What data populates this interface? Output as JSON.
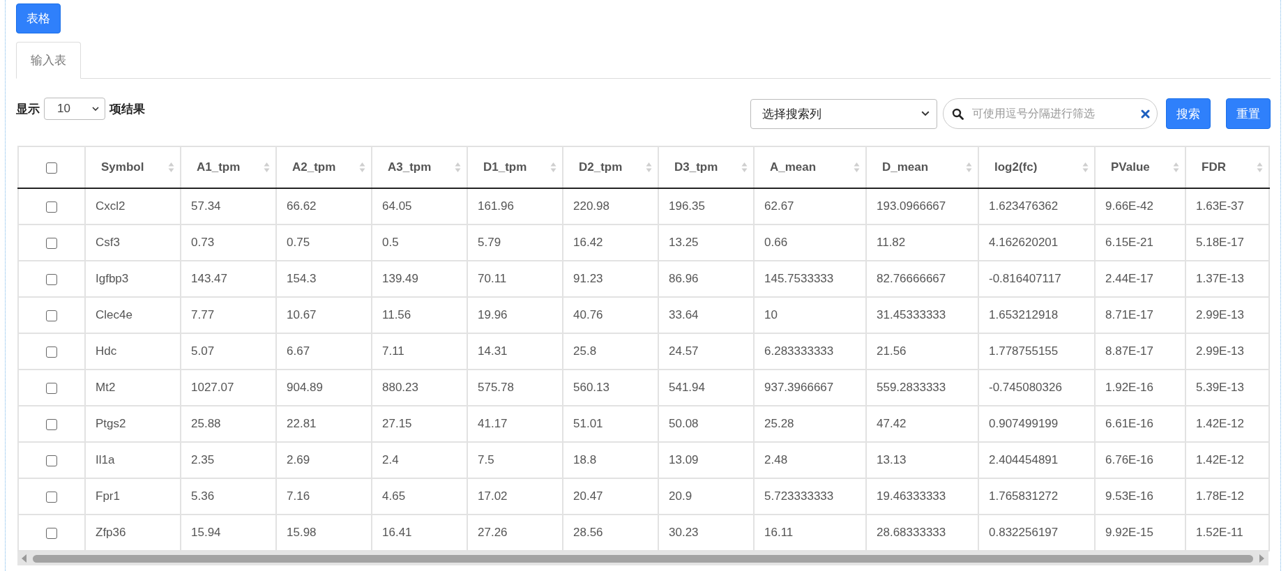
{
  "top_button": "表格",
  "tabs": [
    {
      "label": "输入表",
      "selected": true
    }
  ],
  "page_length": {
    "prefix": "显示",
    "value": "10",
    "suffix": "项结果"
  },
  "search": {
    "column_select": "选择搜索列",
    "placeholder": "可使用逗号分隔进行筛选",
    "buttons": [
      "搜索",
      "重置"
    ]
  },
  "table": {
    "select_all": {
      "checked": false
    },
    "columns": [
      "Symbol",
      "A1_tpm",
      "A2_tpm",
      "A3_tpm",
      "D1_tpm",
      "D2_tpm",
      "D3_tpm",
      "A_mean",
      "D_mean",
      "log2(fc)",
      "PValue",
      "FDR"
    ],
    "rows": [
      {
        "checked": false,
        "cells": [
          "Cxcl2",
          "57.34",
          "66.62",
          "64.05",
          "161.96",
          "220.98",
          "196.35",
          "62.67",
          "193.0966667",
          "1.623476362",
          "9.66E-42",
          "1.63E-37"
        ]
      },
      {
        "checked": false,
        "cells": [
          "Csf3",
          "0.73",
          "0.75",
          "0.5",
          "5.79",
          "16.42",
          "13.25",
          "0.66",
          "11.82",
          "4.162620201",
          "6.15E-21",
          "5.18E-17"
        ]
      },
      {
        "checked": false,
        "cells": [
          "Igfbp3",
          "143.47",
          "154.3",
          "139.49",
          "70.11",
          "91.23",
          "86.96",
          "145.7533333",
          "82.76666667",
          "-0.816407117",
          "2.44E-17",
          "1.37E-13"
        ]
      },
      {
        "checked": false,
        "cells": [
          "Clec4e",
          "7.77",
          "10.67",
          "11.56",
          "19.96",
          "40.76",
          "33.64",
          "10",
          "31.45333333",
          "1.653212918",
          "8.71E-17",
          "2.99E-13"
        ]
      },
      {
        "checked": false,
        "cells": [
          "Hdc",
          "5.07",
          "6.67",
          "7.11",
          "14.31",
          "25.8",
          "24.57",
          "6.283333333",
          "21.56",
          "1.778755155",
          "8.87E-17",
          "2.99E-13"
        ]
      },
      {
        "checked": false,
        "cells": [
          "Mt2",
          "1027.07",
          "904.89",
          "880.23",
          "575.78",
          "560.13",
          "541.94",
          "937.3966667",
          "559.2833333",
          "-0.745080326",
          "1.92E-16",
          "5.39E-13"
        ]
      },
      {
        "checked": false,
        "cells": [
          "Ptgs2",
          "25.88",
          "22.81",
          "27.15",
          "41.17",
          "51.01",
          "50.08",
          "25.28",
          "47.42",
          "0.907499199",
          "6.61E-16",
          "1.42E-12"
        ]
      },
      {
        "checked": false,
        "cells": [
          "Il1a",
          "2.35",
          "2.69",
          "2.4",
          "7.5",
          "18.8",
          "13.09",
          "2.48",
          "13.13",
          "2.404454891",
          "6.76E-16",
          "1.42E-12"
        ]
      },
      {
        "checked": false,
        "cells": [
          "Fpr1",
          "5.36",
          "7.16",
          "4.65",
          "17.02",
          "20.47",
          "20.9",
          "5.723333333",
          "19.46333333",
          "1.765831272",
          "9.53E-16",
          "1.78E-12"
        ]
      },
      {
        "checked": false,
        "cells": [
          "Zfp36",
          "15.94",
          "15.98",
          "16.41",
          "27.26",
          "28.56",
          "30.23",
          "16.11",
          "28.68333333",
          "0.832256197",
          "9.92E-15",
          "1.52E-11"
        ]
      }
    ]
  }
}
